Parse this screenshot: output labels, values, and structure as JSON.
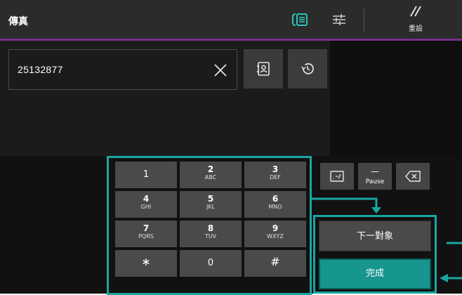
{
  "header": {
    "title": "傳真",
    "reset_label": "重設"
  },
  "recipient": {
    "number": "25132877"
  },
  "keypad": {
    "keys": [
      {
        "main": "1",
        "sub": ""
      },
      {
        "main": "2",
        "sub": "ABC"
      },
      {
        "main": "3",
        "sub": "DEF"
      },
      {
        "main": "4",
        "sub": "GHI"
      },
      {
        "main": "5",
        "sub": "JKL"
      },
      {
        "main": "6",
        "sub": "MNO"
      },
      {
        "main": "7",
        "sub": "PQRS"
      },
      {
        "main": "8",
        "sub": "TUV"
      },
      {
        "main": "9",
        "sub": "WXYZ"
      },
      {
        "main": "∗",
        "sub": ""
      },
      {
        "main": "0",
        "sub": ""
      },
      {
        "main": "#",
        "sub": ""
      }
    ]
  },
  "function_keys": {
    "pause_dash": "—",
    "pause_label": "Pause"
  },
  "actions": {
    "next_label": "下一對象",
    "done_label": "完成"
  },
  "icons": {
    "fax_addressbook": "fax-address-book-icon",
    "settings": "settings-sliders-icon",
    "reset": "reset-slash-icon",
    "clear": "close-icon",
    "address_book": "address-book-icon",
    "history": "history-icon",
    "dial_options": "dial-options-icon",
    "backspace": "backspace-icon"
  },
  "colors": {
    "accent_teal": "#1aa6a1",
    "done_button": "#17958f",
    "header_underline": "#7b2f8c"
  }
}
